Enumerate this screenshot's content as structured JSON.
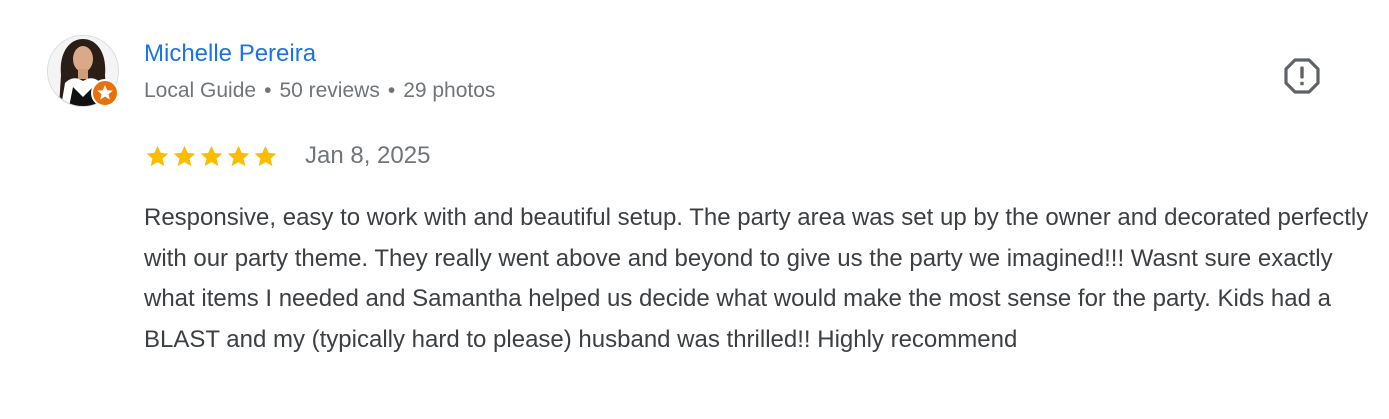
{
  "review": {
    "author": {
      "name": "Michelle Pereira",
      "badge": "Local Guide",
      "reviews": "50 reviews",
      "photos": "29 photos",
      "separator": "•"
    },
    "rating": {
      "stars": 5,
      "max": 5,
      "star_color": "#fbbc04"
    },
    "date": "Jan 8, 2025",
    "text": "Responsive, easy to work with and beautiful setup. The party area was set up by the owner and decorated perfectly with our party theme. They really went above and beyond to give us the party we imagined!!! Wasnt sure exactly what items I needed and Samantha helped us decide what would make the most sense for the party. Kids had a BLAST and my (typically hard to please) husband was thrilled!! Highly recommend",
    "icons": {
      "avatar": "profile-photo",
      "badge": "local-guide-star-badge",
      "report": "report-octagon-exclamation-icon",
      "star": "star-icon"
    },
    "colors": {
      "name": "#1a73e8",
      "meta": "#70757a",
      "text": "#3c4043",
      "badge": "#e8710a"
    }
  }
}
